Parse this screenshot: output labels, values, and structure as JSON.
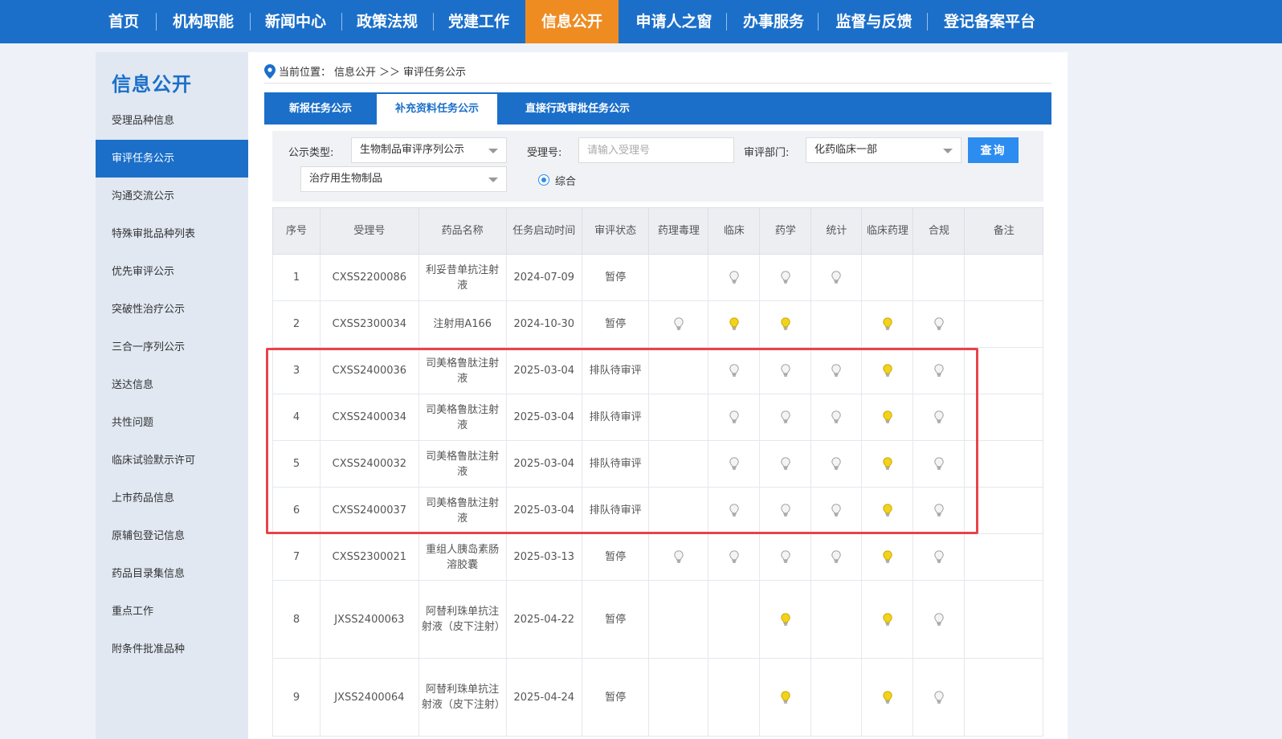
{
  "nav": {
    "items": [
      "首页",
      "机构职能",
      "新闻中心",
      "政策法规",
      "党建工作",
      "信息公开",
      "申请人之窗",
      "办事服务",
      "监督与反馈",
      "登记备案平台"
    ],
    "active": "信息公开"
  },
  "sidebar": {
    "title": "信息公开",
    "items": [
      "受理品种信息",
      "审评任务公示",
      "沟通交流公示",
      "特殊审批品种列表",
      "优先审评公示",
      "突破性治疗公示",
      "三合一序列公示",
      "送达信息",
      "共性问题",
      "临床试验默示许可",
      "上市药品信息",
      "原辅包登记信息",
      "药品目录集信息",
      "重点工作",
      "附条件批准品种"
    ],
    "active": "审评任务公示"
  },
  "breadcrumb": {
    "prefix": "当前位置：",
    "section": "信息公开",
    "sep": "＞＞",
    "current": "审评任务公示"
  },
  "tabs": {
    "items": [
      "新报任务公示",
      "补充资料任务公示",
      "直接行政审批任务公示"
    ],
    "active": "补充资料任务公示"
  },
  "filter": {
    "type_label": "公示类型:",
    "type_value": "生物制品审评序列公示",
    "accept_label": "受理号:",
    "accept_placeholder": "请输入受理号",
    "dept_label": "审评部门:",
    "dept_value": "化药临床一部",
    "query_button": "查询",
    "sub_type_value": "治疗用生物制品",
    "radio_label": "综合"
  },
  "table": {
    "headers": [
      "序号",
      "受理号",
      "药品名称",
      "任务启动时间",
      "审评状态",
      "药理毒理",
      "临床",
      "药学",
      "统计",
      "临床药理",
      "合规",
      "备注"
    ],
    "rows": [
      {
        "no": "1",
        "accept_no": "CXSS2200086",
        "name": "利妥昔单抗注射液",
        "date": "2024-07-09",
        "status": "暂停",
        "bulbs": [
          "none",
          "off",
          "off",
          "off",
          "none",
          "none"
        ],
        "note": ""
      },
      {
        "no": "2",
        "accept_no": "CXSS2300034",
        "name": "注射用A166",
        "date": "2024-10-30",
        "status": "暂停",
        "bulbs": [
          "off",
          "on",
          "on",
          "none",
          "on",
          "off"
        ],
        "note": ""
      },
      {
        "no": "3",
        "accept_no": "CXSS2400036",
        "name": "司美格鲁肽注射液",
        "date": "2025-03-04",
        "status": "排队待审评",
        "bulbs": [
          "none",
          "off",
          "off",
          "off",
          "on",
          "off"
        ],
        "note": ""
      },
      {
        "no": "4",
        "accept_no": "CXSS2400034",
        "name": "司美格鲁肽注射液",
        "date": "2025-03-04",
        "status": "排队待审评",
        "bulbs": [
          "none",
          "off",
          "off",
          "off",
          "on",
          "off"
        ],
        "note": ""
      },
      {
        "no": "5",
        "accept_no": "CXSS2400032",
        "name": "司美格鲁肽注射液",
        "date": "2025-03-04",
        "status": "排队待审评",
        "bulbs": [
          "none",
          "off",
          "off",
          "off",
          "on",
          "off"
        ],
        "note": ""
      },
      {
        "no": "6",
        "accept_no": "CXSS2400037",
        "name": "司美格鲁肽注射液",
        "date": "2025-03-04",
        "status": "排队待审评",
        "bulbs": [
          "none",
          "off",
          "off",
          "off",
          "on",
          "off"
        ],
        "note": ""
      },
      {
        "no": "7",
        "accept_no": "CXSS2300021",
        "name": "重组人胰岛素肠溶胶囊",
        "date": "2025-03-13",
        "status": "暂停",
        "bulbs": [
          "off",
          "off",
          "off",
          "off",
          "on",
          "off"
        ],
        "note": ""
      },
      {
        "no": "8",
        "accept_no": "JXSS2400063",
        "name": "阿替利珠单抗注射液（皮下注射）",
        "date": "2025-04-22",
        "status": "暂停",
        "bulbs": [
          "none",
          "none",
          "on",
          "none",
          "on",
          "off"
        ],
        "note": ""
      },
      {
        "no": "9",
        "accept_no": "JXSS2400064",
        "name": "阿替利珠单抗注射液（皮下注射）",
        "date": "2025-04-24",
        "status": "暂停",
        "bulbs": [
          "none",
          "none",
          "on",
          "none",
          "on",
          "off"
        ],
        "note": ""
      }
    ]
  },
  "colors": {
    "nav_bg": "#1b6fc9",
    "nav_active": "#ee8c22",
    "bulb_on": "#f2d21b",
    "bulb_off": "#bfbfbf",
    "highlight": "#e8434b"
  },
  "icons": {
    "bulb_on": "lightbulb-lit-icon",
    "bulb_off": "lightbulb-unlit-icon",
    "location": "location-pin-icon"
  }
}
